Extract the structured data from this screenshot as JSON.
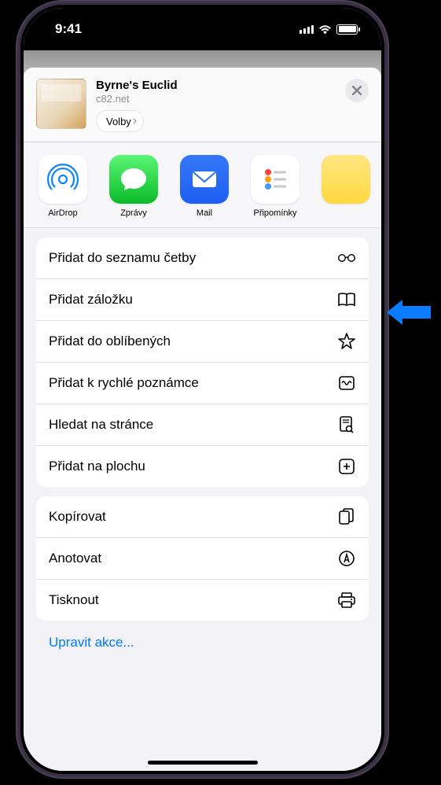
{
  "statusBar": {
    "time": "9:41"
  },
  "header": {
    "title": "Byrne's Euclid",
    "subtitle": "c82.net",
    "optionsLabel": "Volby"
  },
  "apps": [
    {
      "label": "AirDrop",
      "iconName": "airdrop-icon"
    },
    {
      "label": "Zprávy",
      "iconName": "messages-icon"
    },
    {
      "label": "Mail",
      "iconName": "mail-icon"
    },
    {
      "label": "Připomínky",
      "iconName": "reminders-icon"
    },
    {
      "label": "",
      "iconName": "notes-icon"
    }
  ],
  "actionGroups": [
    {
      "items": [
        {
          "label": "Přidat do seznamu četby",
          "iconName": "glasses-icon"
        },
        {
          "label": "Přidat záložku",
          "iconName": "book-icon"
        },
        {
          "label": "Přidat do oblíbených",
          "iconName": "star-icon"
        },
        {
          "label": "Přidat k rychlé poznámce",
          "iconName": "quicknote-icon"
        },
        {
          "label": "Hledat na stránce",
          "iconName": "findonpage-icon"
        },
        {
          "label": "Přidat na plochu",
          "iconName": "addtohome-icon"
        }
      ]
    },
    {
      "items": [
        {
          "label": "Kopírovat",
          "iconName": "copy-icon"
        },
        {
          "label": "Anotovat",
          "iconName": "markup-icon"
        },
        {
          "label": "Tisknout",
          "iconName": "print-icon"
        }
      ]
    }
  ],
  "editActionsLabel": "Upravit akce..."
}
